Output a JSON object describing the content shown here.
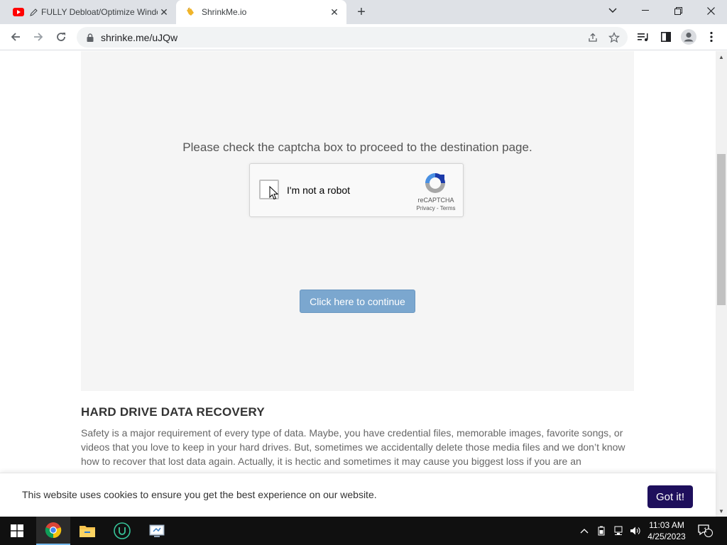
{
  "browser": {
    "tabs": [
      {
        "title": "FULLY Debloat/Optimize Windows",
        "favicon": "youtube-icon"
      },
      {
        "title": "ShrinkMe.io",
        "favicon": "hand-icon"
      }
    ],
    "url": "shrinke.me/uJQw"
  },
  "page": {
    "captcha_message": "Please check the captcha box to proceed to the destination page.",
    "recaptcha": {
      "label": "I'm not a robot",
      "brand": "reCAPTCHA",
      "privacy": "Privacy",
      "separator": " - ",
      "terms": "Terms"
    },
    "continue_label": "Click here to continue",
    "article": {
      "heading": "HARD DRIVE DATA RECOVERY",
      "body": "Safety is a major requirement of every type of data. Maybe, you have credential files, memorable images, favorite songs, or videos that you love to keep in your hard drives. But, sometimes we accidentally delete those media files and we don’t know how to recover that lost data again. Actually, it is hectic and sometimes it may cause you biggest loss if you are an"
    }
  },
  "cookie": {
    "message": "This website uses cookies to ensure you get the best experience on our website.",
    "button": "Got it!"
  },
  "taskbar": {
    "time": "11:03 AM",
    "date": "4/25/2023",
    "notification_count": "1"
  },
  "colors": {
    "continue_button": "#7ba7cf",
    "gotit_button": "#1e0f5c",
    "panel_background": "#f5f5f5"
  }
}
